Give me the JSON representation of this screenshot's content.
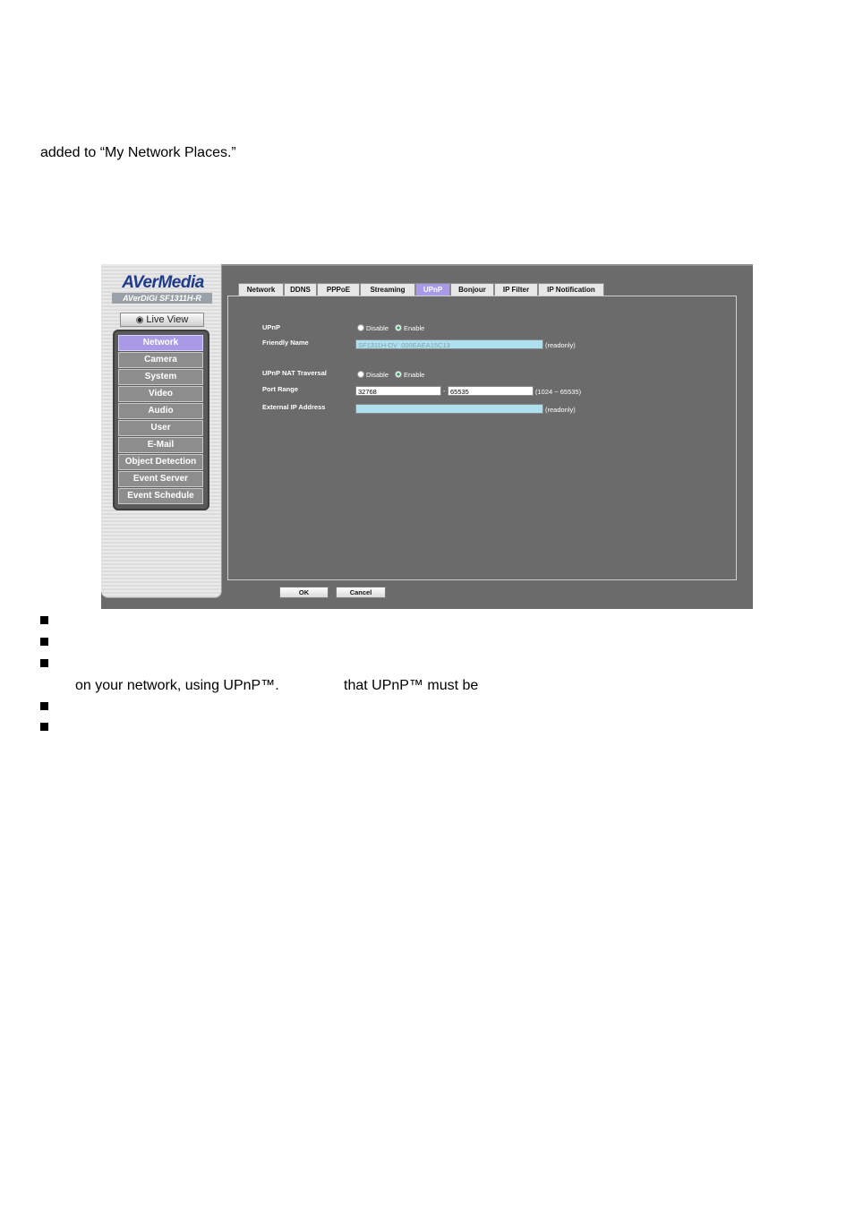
{
  "document": {
    "intro_line": "added to “My Network Places.”",
    "bullet_continuation_a": "on your network, using UPnP™.",
    "bullet_continuation_b": "that UPnP™ must be"
  },
  "screenshot": {
    "brand": "AVerMedia",
    "brand_sub": "AVerDiGi SF1311H-R",
    "live_view": "Live View",
    "menu": [
      {
        "label": "Network",
        "active": true
      },
      {
        "label": "Camera"
      },
      {
        "label": "System"
      },
      {
        "label": "Video"
      },
      {
        "label": "Audio"
      },
      {
        "label": "User"
      },
      {
        "label": "E-Mail"
      },
      {
        "label": "Object Detection"
      },
      {
        "label": "Event Server"
      },
      {
        "label": "Event Schedule"
      }
    ],
    "tabs": [
      "Network",
      "DDNS",
      "PPPoE",
      "Streaming",
      "UPnP",
      "Bonjour",
      "IP Filter",
      "IP Notification"
    ],
    "active_tab": "UPnP",
    "form": {
      "upnp_label": "UPnP",
      "disable": "Disable",
      "enable": "Enable",
      "friendly_name_label": "Friendly Name",
      "friendly_name_value": "SF1311H-DV_000EAEA15C13",
      "readonly": "(readonly)",
      "nat_label": "UPnP NAT Traversal",
      "port_range_label": "Port Range",
      "port_from": "32768",
      "port_sep": "-",
      "port_to": "65535",
      "port_hint": "(1024 ~ 65535)",
      "external_ip_label": "External IP Address",
      "external_ip_value": ""
    },
    "ok": "OK",
    "cancel": "Cancel"
  },
  "colors": {
    "accent": "#a89ae6",
    "panel_bg": "#6b6b6b",
    "readonly_field": "#aee0ef"
  }
}
